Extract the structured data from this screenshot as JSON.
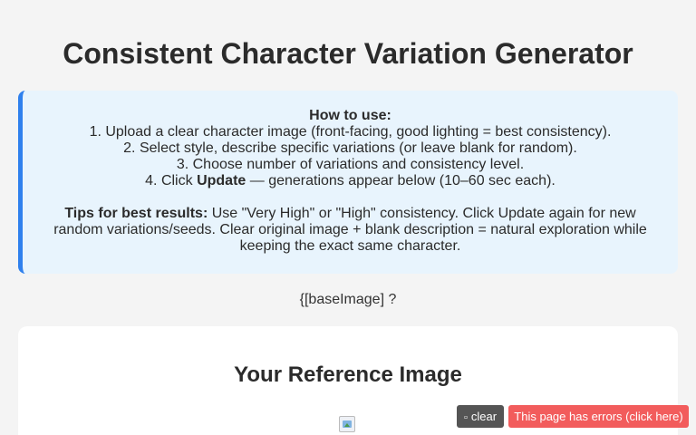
{
  "header": {
    "title": "Consistent Character Variation Generator"
  },
  "howto": {
    "heading": "How to use:",
    "steps": [
      "1. Upload a clear character image (front-facing, good lighting = best consistency).",
      "2. Select style, describe specific variations (or leave blank for random).",
      "3. Choose number of variations and consistency level."
    ],
    "step4_prefix": "4. Click",
    "step4_bold": "Update",
    "step4_suffix": " — generations appear below (10–60 sec each).",
    "tips_label": "Tips for best results:",
    "tips_text": " Use \"Very High\" or \"High\" consistency. Click Update again for new random variations/seeds. Clear original image + blank description = natural exploration while keeping the exact same character."
  },
  "placeholder_text": "{[baseImage] ?",
  "reference_card": {
    "title": "Your Reference Image"
  },
  "toolbar": {
    "clear_icon": "trash-icon",
    "clear_label": "clear",
    "error_label": "This page has errors (click here)"
  },
  "colors": {
    "accent": "#2f80ed",
    "howto_bg": "#e8f4fd",
    "error_bg": "#f25c5c",
    "clear_bg": "#555555"
  }
}
